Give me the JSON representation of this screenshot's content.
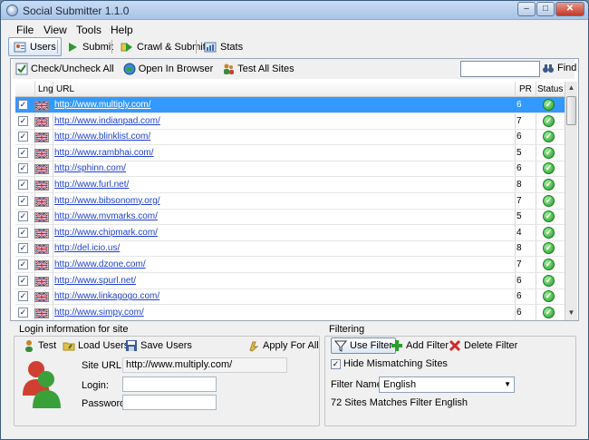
{
  "window": {
    "title": "Social Submitter 1.1.0"
  },
  "menu": [
    "File",
    "View",
    "Tools",
    "Help"
  ],
  "tabs": [
    {
      "label": "Users",
      "icon": "users-icon",
      "active": true
    },
    {
      "label": "Submit",
      "icon": "play-icon",
      "active": false
    },
    {
      "label": "Crawl & Submit",
      "icon": "crawl-icon",
      "active": false
    },
    {
      "label": "Stats",
      "icon": "stats-icon",
      "active": false
    }
  ],
  "toolbar": {
    "check_all": "Check/Uncheck All",
    "open_browser": "Open In Browser",
    "test_all": "Test All Sites",
    "find": "Find",
    "search_value": ""
  },
  "grid": {
    "columns": {
      "lng": "Lng",
      "url": "URL",
      "pr": "PR",
      "status": "Status"
    },
    "rows": [
      {
        "url": "http://www.multiply.com/",
        "pr": "6",
        "checked": true,
        "selected": true
      },
      {
        "url": "http://www.indianpad.com/",
        "pr": "7",
        "checked": true,
        "selected": false
      },
      {
        "url": "http://www.blinklist.com/",
        "pr": "6",
        "checked": true,
        "selected": false
      },
      {
        "url": "http://www.rambhai.com/",
        "pr": "5",
        "checked": true,
        "selected": false
      },
      {
        "url": "http://sphinn.com/",
        "pr": "6",
        "checked": true,
        "selected": false
      },
      {
        "url": "http://www.furl.net/",
        "pr": "8",
        "checked": true,
        "selected": false
      },
      {
        "url": "http://www.bibsonomy.org/",
        "pr": "7",
        "checked": true,
        "selected": false
      },
      {
        "url": "http://www.mvmarks.com/",
        "pr": "5",
        "checked": true,
        "selected": false
      },
      {
        "url": "http://www.chipmark.com/",
        "pr": "4",
        "checked": true,
        "selected": false
      },
      {
        "url": "http://del.icio.us/",
        "pr": "8",
        "checked": true,
        "selected": false
      },
      {
        "url": "http://www.dzone.com/",
        "pr": "7",
        "checked": true,
        "selected": false
      },
      {
        "url": "http://www.spurl.net/",
        "pr": "6",
        "checked": true,
        "selected": false
      },
      {
        "url": "http://www.linkagogo.com/",
        "pr": "6",
        "checked": true,
        "selected": false
      },
      {
        "url": "http://www.simpy.com/",
        "pr": "6",
        "checked": true,
        "selected": false
      }
    ]
  },
  "login": {
    "group_title": "Login information for site",
    "test": "Test",
    "load_users": "Load Users",
    "save_users": "Save Users",
    "apply_all": "Apply For All",
    "site_url_label": "Site URL:",
    "site_url_value": "http://www.multiply.com/",
    "login_label": "Login:",
    "login_value": "",
    "password_label": "Password:",
    "password_value": ""
  },
  "filtering": {
    "group_title": "Filtering",
    "use_filter": "Use Filter",
    "add_filter": "Add Filter",
    "delete_filter": "Delete Filter",
    "hide_mismatching": "Hide Mismatching Sites",
    "filter_name_label": "Filter Name:",
    "filter_name_value": "English",
    "match_text": "72 Sites Matches Filter English"
  },
  "colors": {
    "selection": "#3399ff",
    "link": "#1f3fd0",
    "status_ok": "#1f9a1f"
  }
}
